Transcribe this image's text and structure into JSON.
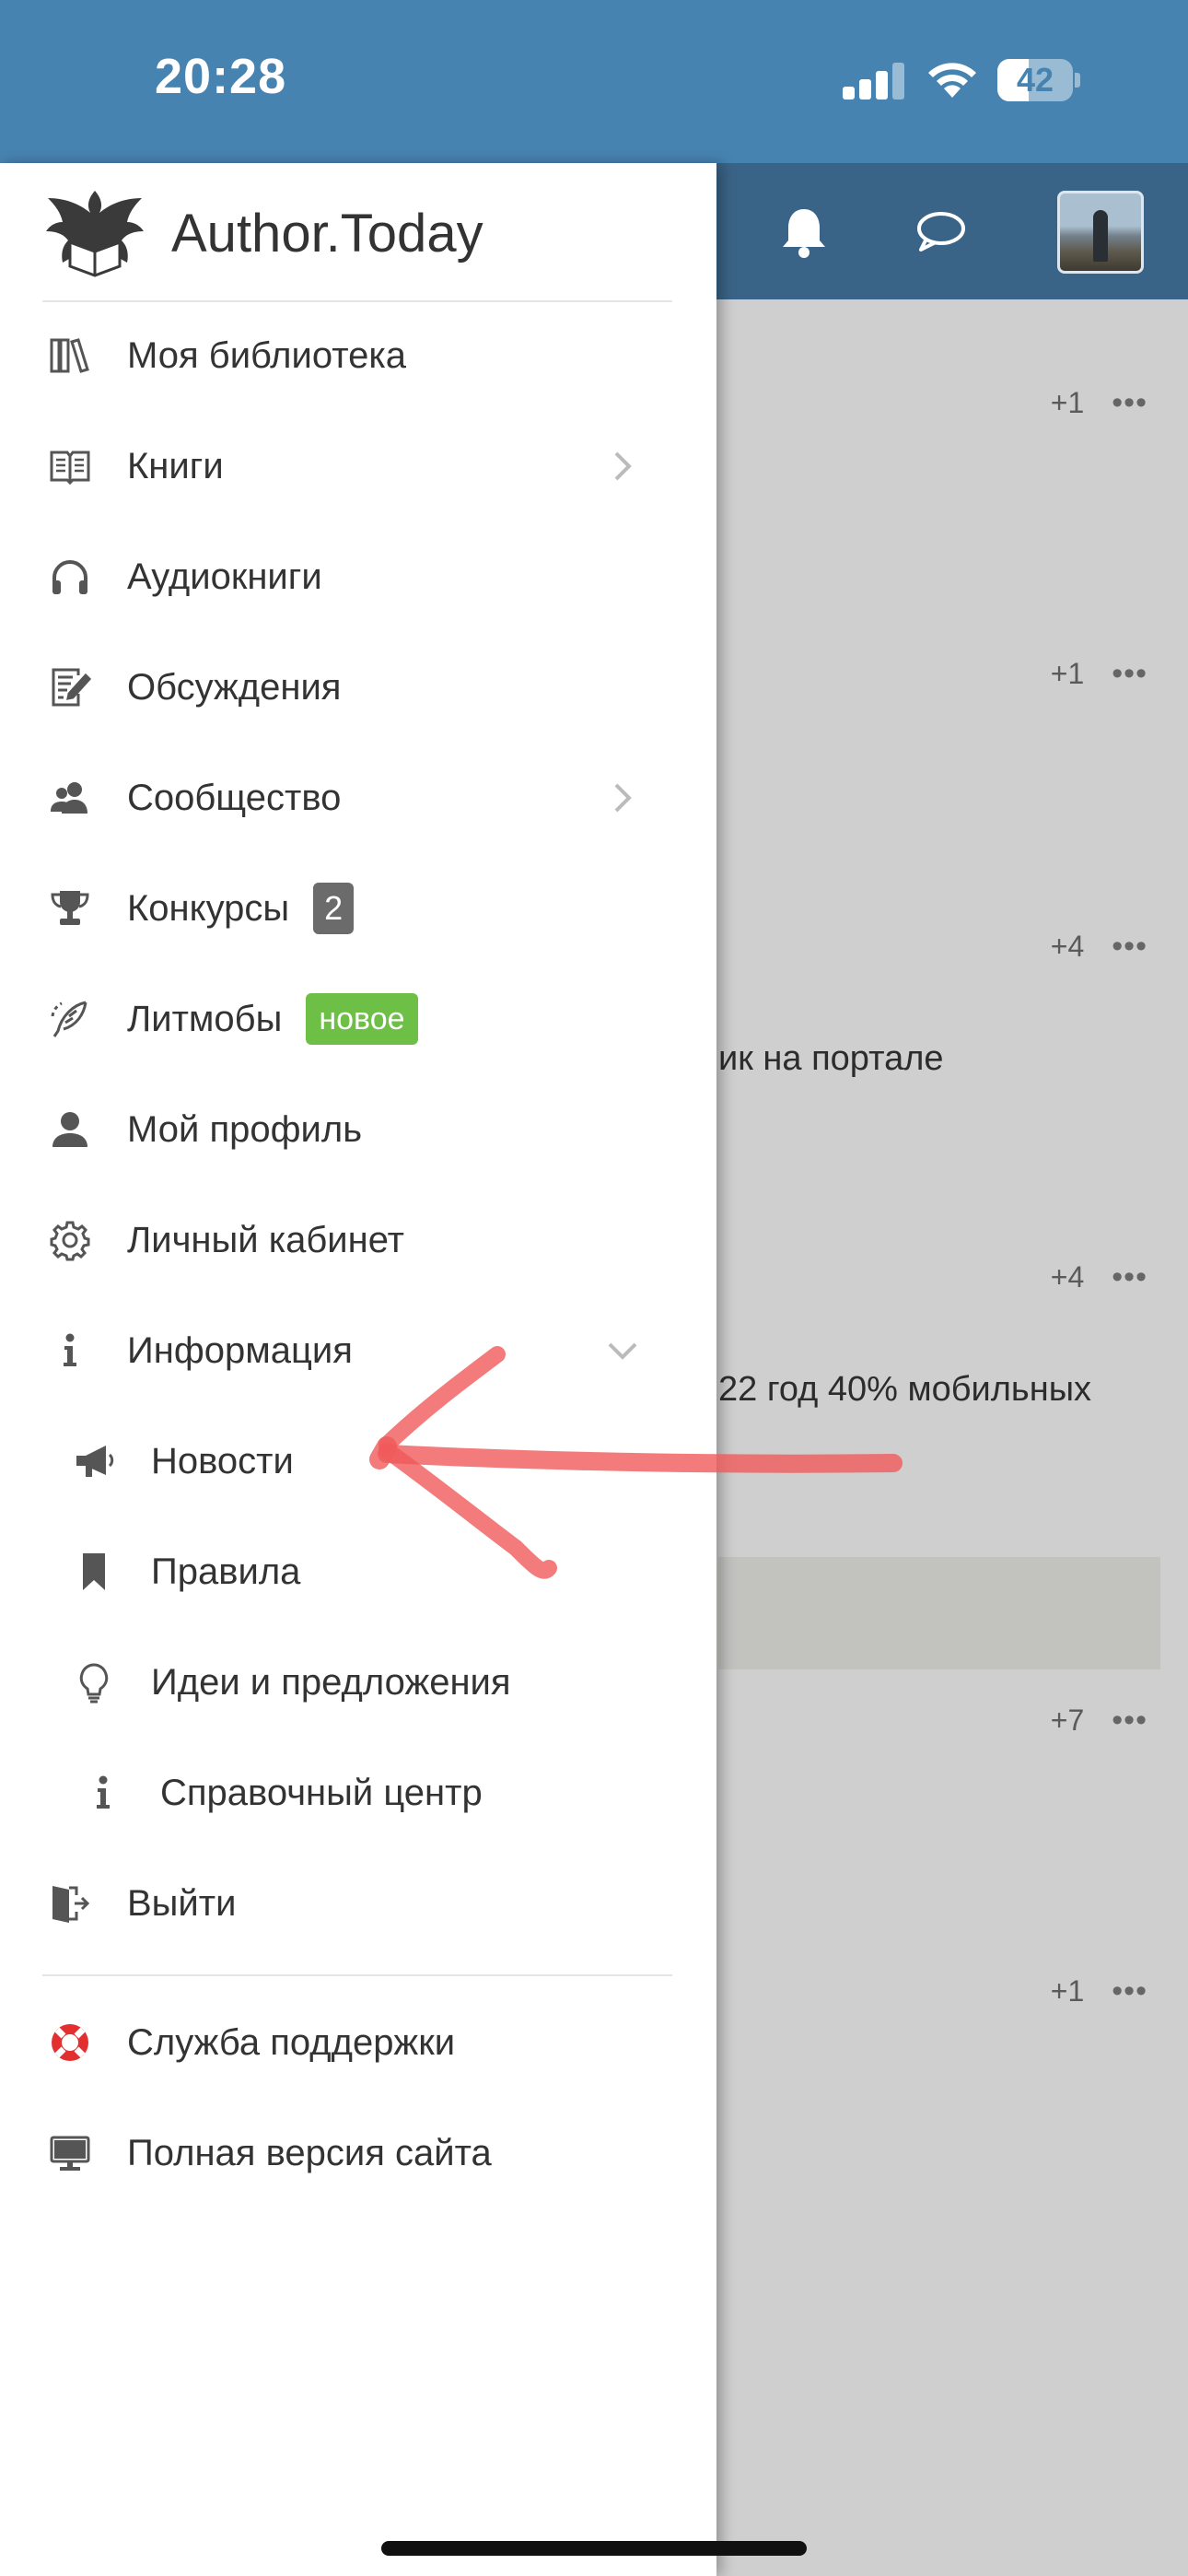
{
  "status_bar": {
    "time": "20:28",
    "battery": "42",
    "battery_level": 0.42
  },
  "app_header": {
    "icons": [
      "bell-icon",
      "chat-icon"
    ],
    "avatar": "user-avatar"
  },
  "feed": {
    "meta": [
      {
        "count": "+1",
        "more": "•••"
      },
      {
        "count": "+1",
        "more": "•••"
      },
      {
        "count": "+4",
        "more": "•••"
      },
      {
        "count": "+4",
        "more": "•••"
      },
      {
        "count": "+7",
        "more": "•••"
      },
      {
        "count": "+1",
        "more": "•••"
      }
    ],
    "text_1": "ик на портале",
    "text_2": "22 год 40% мобильных"
  },
  "drawer": {
    "brand": "Author.Today",
    "menu": [
      {
        "label": "Моя библиотека",
        "icon": "books-icon"
      },
      {
        "label": "Книги",
        "icon": "open-book-icon"
      },
      {
        "label": "Аудиокниги",
        "icon": "headphones-icon"
      },
      {
        "label": "Обсуждения",
        "icon": "edit-document-icon"
      },
      {
        "label": "Сообщество",
        "icon": "community-icon"
      },
      {
        "label": "Конкурсы",
        "icon": "trophy-icon",
        "badge": "2"
      },
      {
        "label": "Литмобы",
        "icon": "quill-icon",
        "badge": "новое"
      },
      {
        "label": "Мой профиль",
        "icon": "user-icon"
      },
      {
        "label": "Личный кабинет",
        "icon": "gear-icon"
      },
      {
        "label": "Информация",
        "icon": "info-icon"
      }
    ],
    "submenu": [
      {
        "label": "Новости",
        "icon": "megaphone-icon"
      },
      {
        "label": "Правила",
        "icon": "bookmark-icon"
      },
      {
        "label": "Идеи и предложения",
        "icon": "lightbulb-icon"
      },
      {
        "label": "Справочный центр",
        "icon": "info-icon"
      }
    ],
    "logout": {
      "label": "Выйти",
      "icon": "exit-icon"
    },
    "footer": [
      {
        "label": "Служба поддержки",
        "icon": "lifebuoy-icon"
      },
      {
        "label": "Полная версия сайта",
        "icon": "desktop-icon"
      }
    ]
  },
  "colors": {
    "status_bar": "#4783b1",
    "app_header": "#3a6487",
    "badge_new": "#6dbf45",
    "badge_count": "#6b6b6b",
    "annotation": "#f05a5a"
  }
}
